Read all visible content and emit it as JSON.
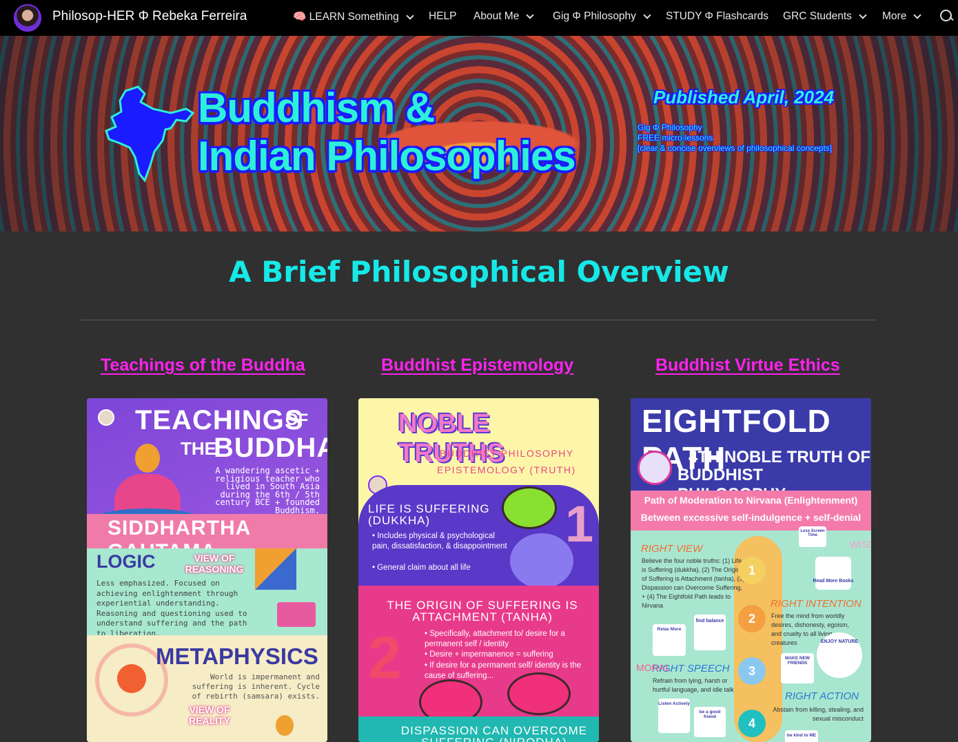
{
  "nav": {
    "site_title": "Philosop-HER Φ Rebeka Ferreira",
    "items": [
      {
        "label": "🧠 LEARN Something",
        "has_menu": true
      },
      {
        "label": "HELP",
        "has_menu": false
      },
      {
        "label": "About Me",
        "has_menu": true
      },
      {
        "label": "Gig Φ Philosophy",
        "has_menu": true
      },
      {
        "label": "STUDY Φ Flashcards",
        "has_menu": false
      },
      {
        "label": "GRC Students",
        "has_menu": true
      },
      {
        "label": "More",
        "has_menu": true
      }
    ]
  },
  "hero": {
    "title_line1": "Buddhism &",
    "title_line2": "Indian Philosophies",
    "published": "Published April, 2024",
    "note_line1": "Gig Φ Philosophy",
    "note_line2": "FREE micro-lessons",
    "note_line3": "[clear & concise overviews of philosophical concepts]"
  },
  "main": {
    "heading": "A Brief Philosophical Overview",
    "columns": [
      {
        "link": "Teachings of the Buddha"
      },
      {
        "link": "Buddhist Epistemology"
      },
      {
        "link": "Buddhist Virtue Ethics"
      }
    ]
  },
  "card1": {
    "title_a": "TEACHINGS",
    "title_of": "OF",
    "title_the": "THE",
    "title_b": "BUDDHA",
    "intro": "A wandering ascetic + religious teacher who lived in South Asia during the 6th / 5th century BCE + founded Buddhism.",
    "name": "SIDDHARTHA GAUTAMA",
    "logic_title": "LOGIC",
    "logic_sub": "VIEW OF REASONING",
    "logic_text": "Less emphasized. Focused on achieving enlightenment through experiential understanding. Reasoning and questioning used to understand suffering and the path to liberation.",
    "meta_title": "METAPHYSICS",
    "meta_text": "World is impermanent and suffering is inherent. Cycle of rebirth (samsara) exists.",
    "meta_sub": "VIEW OF REALITY"
  },
  "card2": {
    "title": "NOBLE TRUTHS",
    "sub1": "BUDDHIST PHILOSOPHY",
    "sub2": "EPISTEMOLOGY (TRUTH)",
    "t1_title": "LIFE IS SUFFERING (DUKKHA)",
    "t1_b1": "Includes physical & psychological pain, dissatisfaction, & disappointment",
    "t1_b2": "General claim about all life",
    "num1": "1",
    "t2_title": "THE ORIGIN OF SUFFERING IS ATTACHMENT (TANHA)",
    "t2_b1": "Specifically, attachment to/ desire for a permanent self / identity",
    "t2_b2": "Desire + impermanence = suffering",
    "t2_b3": "If desire for a permanent self/ identity is the cause of suffering...",
    "num2": "2",
    "t3_title": "DISPASSION CAN OVERCOME SUFFERING (NIRODHA)"
  },
  "card3": {
    "title": "EIGHTFOLD PATH",
    "sub1": "4TH NOBLE TRUTH OF",
    "sub2": "BUDDHIST PHILOSOPHY",
    "band1": "Path of Moderation to Nirvana (Enlightenment)",
    "band2": "Between excessive self-indulgence + self-denial",
    "rv_title": "RIGHT VIEW",
    "rv_text": "Believe the four noble truths: (1) Life is Suffering (dukkha), (2) The Origin of Suffering is Attachment (tanha), (3) Dispassion can Overcome Suffering, + (4) The Eightfold Path leads to Nirvana",
    "ri_title": "RIGHT INTENTION",
    "ri_text": "Free the mind from worldly desires, dishonesty, egoism, and cruelty to all living creatures",
    "rs_title": "RIGHT SPEECH",
    "rs_text": "Refrain from lying, harsh or hurtful language, and idle talk",
    "ra_title": "RIGHT ACTION",
    "ra_text": "Abstain from killing, stealing, and sexual misconduct",
    "n1": "1",
    "n2": "2",
    "n3": "3",
    "n4": "4",
    "wisdom": "WISDOM",
    "moral": "MORAL",
    "sticker_read": "Read More Books",
    "sticker_enjoy": "ENJOY NATURE",
    "sticker_balance": "find balance",
    "sticker_relax": "Relax More",
    "sticker_friends": "MAKE NEW FRIENDS",
    "sticker_listen": "Listen Actively",
    "sticker_goodfriend": "be a good friend",
    "sticker_kind": "be kind to ME",
    "sticker_less": "Less Screen Time"
  },
  "colors": {
    "accent_cyan": "#16e8e8",
    "link_magenta": "#ff22ee",
    "nav_bg": "#000000",
    "page_bg": "#303030"
  }
}
